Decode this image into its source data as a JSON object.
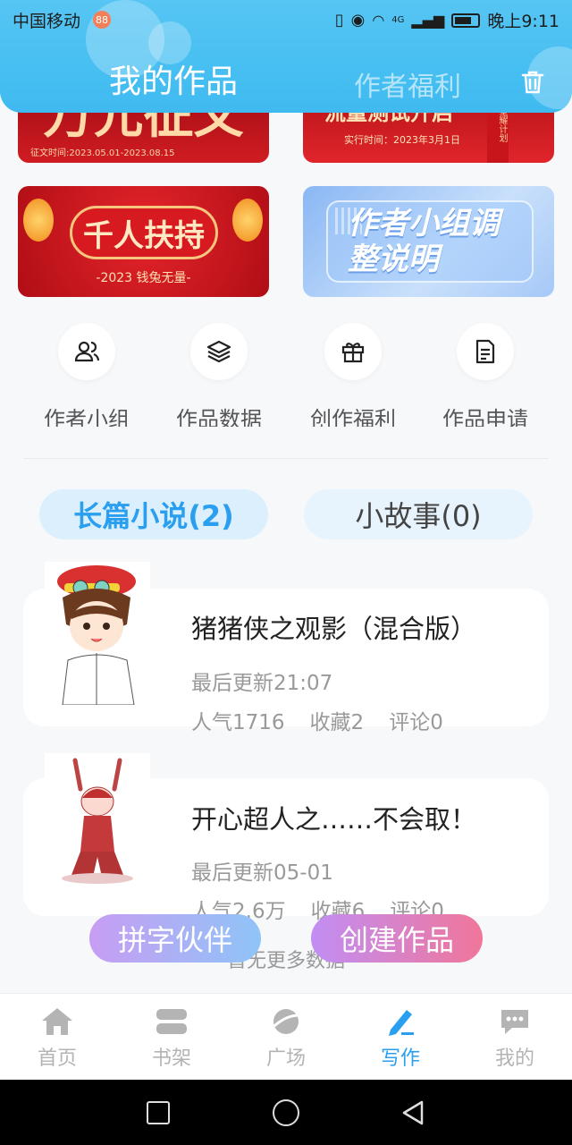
{
  "status": {
    "carrier": "中国移动",
    "carrier_badge": "88",
    "network": "4G",
    "time": "晚上9:11"
  },
  "header": {
    "tab_active": "我的作品",
    "tab_inactive": "作者福利",
    "trash_icon": "trash-icon"
  },
  "banners": [
    {
      "name": "banner-top-left",
      "text": "万元征文",
      "sub": "征文时间:2023.05.01-2023.08.15"
    },
    {
      "name": "banner-top-right",
      "text": "流量测试开启",
      "sub": "实行时间：2023年3月1日",
      "side": "星耀计划"
    },
    {
      "name": "banner-support",
      "text": "千人扶持",
      "sub": "-2023 钱兔无量-"
    },
    {
      "name": "banner-group",
      "text_line1": "作者小组调",
      "text_line2": "整说明"
    }
  ],
  "shortcuts": [
    {
      "label": "作者小组",
      "icon": "users-icon"
    },
    {
      "label": "作品数据",
      "icon": "layers-icon"
    },
    {
      "label": "创作福利",
      "icon": "gift-icon"
    },
    {
      "label": "作品申请",
      "icon": "document-icon"
    }
  ],
  "tabs": {
    "novel": "长篇小说(2)",
    "story": "小故事(0)"
  },
  "works": [
    {
      "title": "猪猪侠之观影（混合版）",
      "updated": "最后更新21:07",
      "popularity": "人气1716",
      "favorites": "收藏2",
      "comments": "评论0"
    },
    {
      "title": "开心超人之……不会取！",
      "updated": "最后更新05-01",
      "popularity": "人气2.6万",
      "favorites": "收藏6",
      "comments": "评论0"
    }
  ],
  "fab": {
    "partner": "拼字伙伴",
    "create": "创建作品"
  },
  "no_more": "暂无更多数据",
  "tabbar": [
    {
      "label": "首页",
      "icon": "home-icon"
    },
    {
      "label": "书架",
      "icon": "bookshelf-icon"
    },
    {
      "label": "广场",
      "icon": "planet-icon"
    },
    {
      "label": "写作",
      "icon": "pen-icon"
    },
    {
      "label": "我的",
      "icon": "chat-bubble-icon"
    }
  ],
  "colors": {
    "accent": "#2a9ff0",
    "header": "#47bff2"
  }
}
